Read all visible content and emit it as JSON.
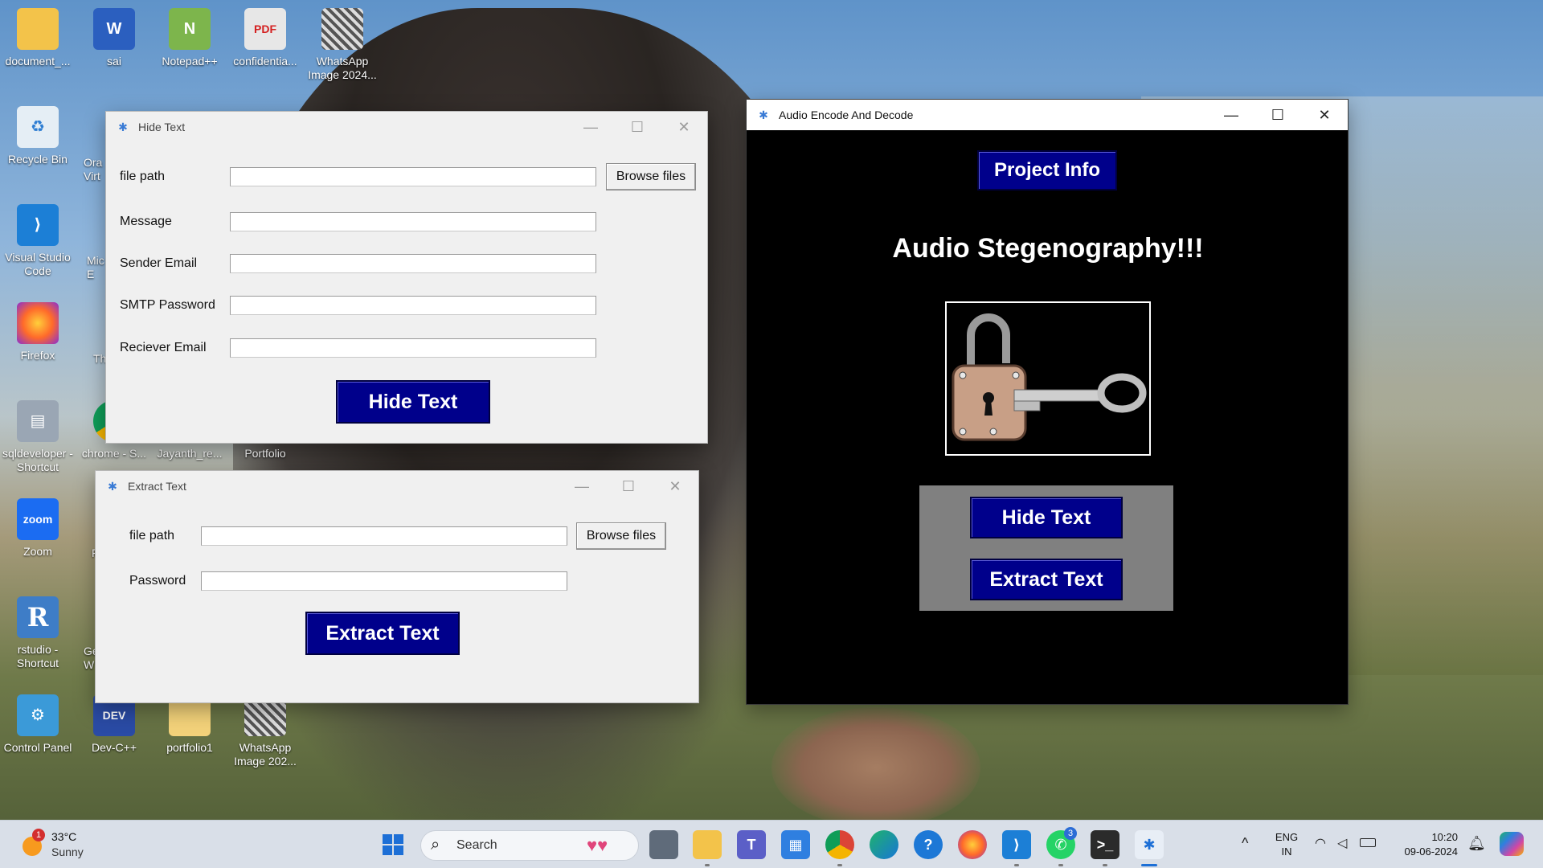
{
  "desktop": {
    "icons": [
      {
        "label": "document_...",
        "glyph": "",
        "icon": "folder-icon"
      },
      {
        "label": "sai",
        "glyph": "W",
        "icon": "word-document-icon"
      },
      {
        "label": "Notepad++",
        "glyph": "N",
        "icon": "notepad-plus-plus-icon"
      },
      {
        "label": "confidentia...",
        "glyph": "PDF",
        "icon": "pdf-icon"
      },
      {
        "label": "WhatsApp Image 2024...",
        "glyph": "",
        "icon": "qr-image-icon"
      },
      {
        "label": "Recycle Bin",
        "glyph": "♻",
        "icon": "recycle-bin-icon"
      },
      {
        "label": "Visual Studio Code",
        "glyph": "⟩",
        "icon": "vscode-icon"
      },
      {
        "label": "Firefox",
        "glyph": "",
        "icon": "firefox-icon"
      },
      {
        "label": "sqldeveloper - Shortcut",
        "glyph": "▤",
        "icon": "sqldeveloper-icon"
      },
      {
        "label": "chrome - S...",
        "glyph": "",
        "icon": "chrome-icon"
      },
      {
        "label": "Jayanth_re...",
        "glyph": "",
        "icon": "document-icon"
      },
      {
        "label": "Portfolio",
        "glyph": "",
        "icon": "document-icon"
      },
      {
        "label": "Zoom",
        "glyph": "zoom",
        "icon": "zoom-icon"
      },
      {
        "label": "rstudio - Shortcut",
        "glyph": "R",
        "icon": "rstudio-icon"
      },
      {
        "label": "Control Panel",
        "glyph": "⚙",
        "icon": "control-panel-icon"
      },
      {
        "label": "Dev-C++",
        "glyph": "DEV",
        "icon": "dev-cpp-icon"
      },
      {
        "label": "portfolio1",
        "glyph": "",
        "icon": "folder-icon"
      },
      {
        "label": "WhatsApp Image 202...",
        "glyph": "",
        "icon": "qr-image-icon"
      }
    ],
    "partial_labels": [
      "Ora Virt",
      "Mic E",
      "Th",
      "Ge W",
      "F"
    ]
  },
  "hide_window": {
    "title": "Hide Text",
    "fields": [
      {
        "label": "file path",
        "value": ""
      },
      {
        "label": "Message",
        "value": ""
      },
      {
        "label": "Sender Email",
        "value": ""
      },
      {
        "label": "SMTP Password",
        "value": ""
      },
      {
        "label": "Reciever Email",
        "value": ""
      }
    ],
    "browse_label": "Browse files",
    "submit_label": "Hide Text"
  },
  "extract_window": {
    "title": "Extract Text",
    "fields": [
      {
        "label": "file path",
        "value": ""
      },
      {
        "label": "Password",
        "value": ""
      }
    ],
    "browse_label": "Browse files",
    "submit_label": "Extract Text"
  },
  "main_window": {
    "title": "Audio Encode And Decode",
    "project_info_label": "Project Info",
    "heading": "Audio Stegenography!!!",
    "hide_label": "Hide Text",
    "extract_label": "Extract Text",
    "colors": {
      "background": "#000000",
      "button": "#00008b",
      "panel": "#808080"
    }
  },
  "window_controls": {
    "minimize": "—",
    "maximize": "☐",
    "close": "✕"
  },
  "taskbar": {
    "weather_temp": "33°C",
    "weather_desc": "Sunny",
    "weather_badge": "1",
    "search_placeholder": "Search",
    "whatsapp_badge": "3",
    "lang_top": "ENG",
    "lang_bottom": "IN",
    "time": "10:20",
    "date": "09-06-2024",
    "tray_chevron": "^",
    "apps": [
      "start-icon",
      "task-view-icon",
      "file-explorer-icon",
      "teams-icon",
      "microsoft-store-icon",
      "chrome-icon",
      "edge-icon",
      "help-icon",
      "firefox-icon",
      "vscode-icon",
      "whatsapp-icon",
      "terminal-icon",
      "python-app-icon"
    ]
  }
}
